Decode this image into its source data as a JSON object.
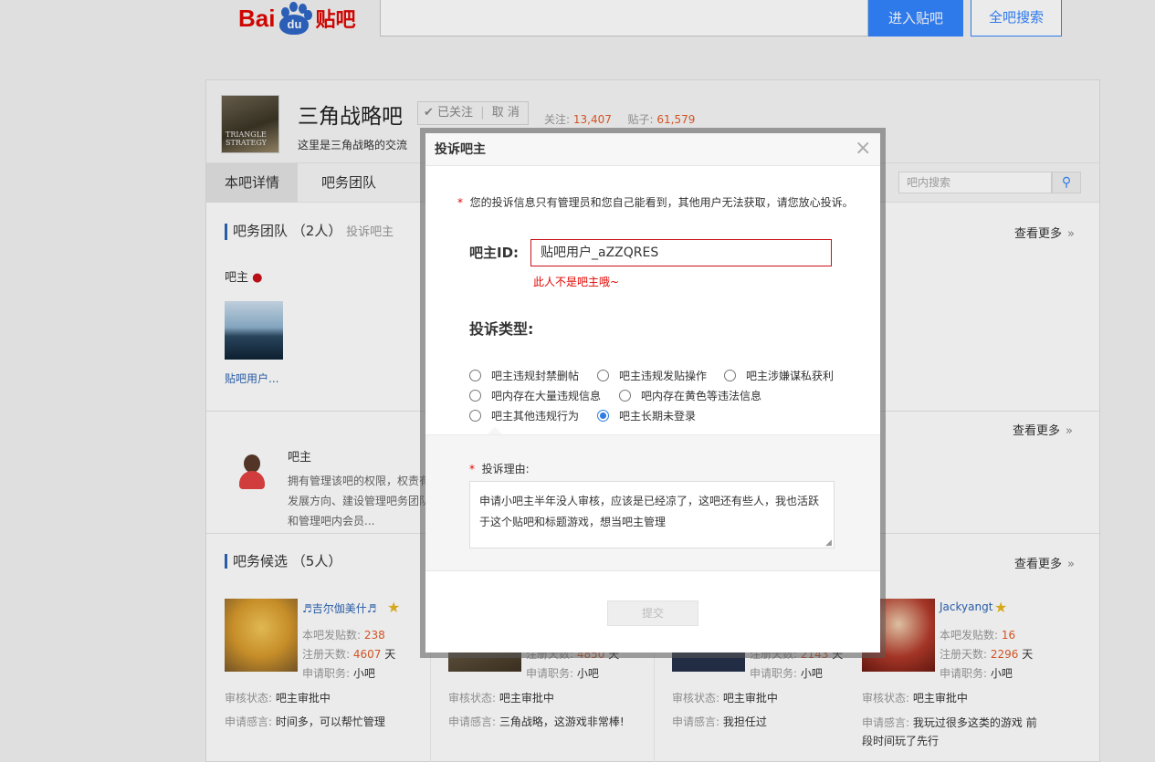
{
  "header": {
    "logo_bai": "Bai",
    "logo_du": "du",
    "logo_cn": "贴吧",
    "enter_button": "进入贴吧",
    "search_all_button": "全吧搜索"
  },
  "forum": {
    "thumb_text": "TRIANGLE STRATEGY",
    "name": "三角战略吧",
    "followed": "已关注",
    "cancel": "取 消",
    "follow_label": "关注:",
    "follow_count": "13,407",
    "post_label": "贴子:",
    "post_count": "61,579",
    "desc": "这里是三角战略的交流"
  },
  "tabs": {
    "detail": "本吧详情",
    "team": "吧务团队"
  },
  "inner_search": {
    "placeholder": "吧内搜索"
  },
  "team": {
    "title": "吧务团队",
    "count": "（2人）",
    "complain": "投诉吧主",
    "more": "查看更多",
    "role": "吧主",
    "member": "贴吧用户..."
  },
  "role_desc": {
    "title": "吧主",
    "line1": "拥有管理该吧的权限，权责有",
    "line2": "发展方向、建设管理吧务团队",
    "line3": "和管理吧内会员...",
    "more": "查看更多"
  },
  "candidates": {
    "title": "吧务候选",
    "count": "（5人）",
    "more": "查看更多",
    "labels": {
      "posts": "本吧发贴数:",
      "days": "注册天数:",
      "days_unit": "天",
      "duty": "申请职务:",
      "status": "审核状态:",
      "speech": "申请感言:"
    },
    "c1": {
      "name": "♬吉尔伽美什♬",
      "posts": "238",
      "days": "4607",
      "duty": "小吧",
      "status": "吧主审批中",
      "speech": "时间多，可以帮忙管理"
    },
    "c2": {
      "days": "4850",
      "duty": "小吧",
      "status": "吧主审批中",
      "speech": "三角战略，这游戏非常棒!"
    },
    "c3": {
      "days": "2143",
      "duty": "小吧",
      "status": "吧主审批中",
      "speech": "我担任过"
    },
    "c4": {
      "name": "Jackyangt",
      "posts": "16",
      "days": "2296",
      "duty": "小吧",
      "status": "吧主审批中",
      "speech1": "我玩过很多这类的游戏 前",
      "speech2": "段时间玩了先行"
    }
  },
  "dialog": {
    "title": "投诉吧主",
    "close": "×",
    "note_star": "*",
    "note": "您的投诉信息只有管理员和您自己能看到，其他用户无法获取，请您放心投诉。",
    "id_label": "吧主ID:",
    "id_value": "贴吧用户_aZZQRES",
    "error": "此人不是吧主哦~",
    "type_label": "投诉类型:",
    "options": [
      "吧主违规封禁删帖",
      "吧主违规发贴操作",
      "吧主涉嫌谋私获利",
      "吧内存在大量违规信息",
      "吧内存在黄色等违法信息",
      "吧主其他违规行为",
      "吧主长期未登录"
    ],
    "selected_option": "吧主长期未登录",
    "reason_label": "投诉理由:",
    "reason_text": "申请小吧主半年没人审核，应该是已经凉了，这吧还有些人，我也活跃于这个贴吧和标题游戏，想当吧主管理",
    "submit": "提交"
  },
  "colors": {
    "brand_red": "#e10602",
    "brand_blue": "#3385ff",
    "title_bar": "#2d64b3",
    "number_orange": "#e45c29"
  }
}
